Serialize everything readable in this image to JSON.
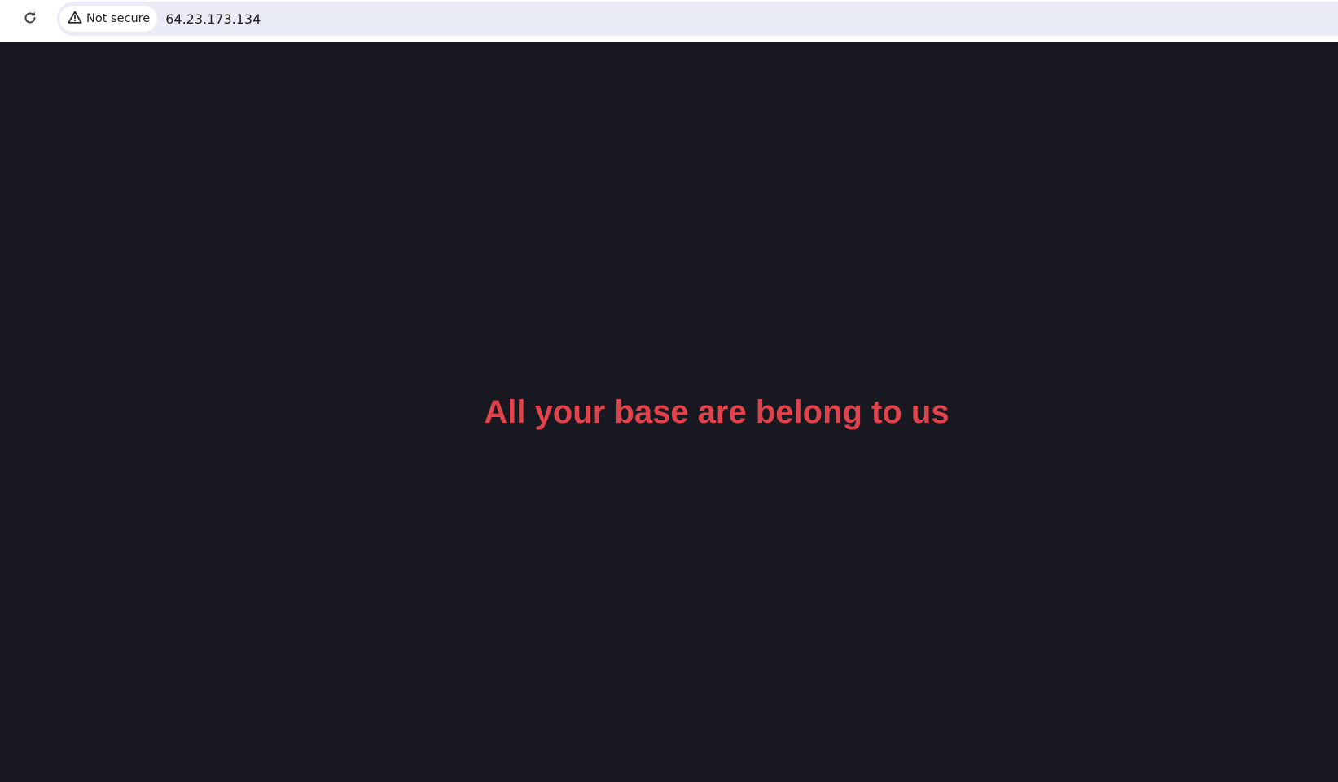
{
  "browser": {
    "security_label": "Not secure",
    "url": "64.23.173.134",
    "icons": {
      "reload": "reload-icon",
      "security": "warning-triangle-icon"
    }
  },
  "page": {
    "message": "All your base are belong to us"
  },
  "colors": {
    "page_background": "#181820",
    "message_color": "#e0434c",
    "toolbar_background": "#ffffff",
    "omnibox_background": "#e9ecf5"
  }
}
